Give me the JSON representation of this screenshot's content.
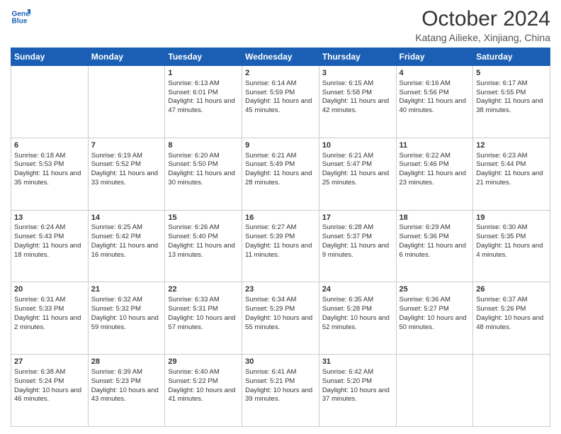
{
  "logo": {
    "line1": "General",
    "line2": "Blue"
  },
  "title": "October 2024",
  "subtitle": "Katang Ailieke, Xinjiang, China",
  "days_of_week": [
    "Sunday",
    "Monday",
    "Tuesday",
    "Wednesday",
    "Thursday",
    "Friday",
    "Saturday"
  ],
  "weeks": [
    [
      {
        "day": "",
        "info": ""
      },
      {
        "day": "",
        "info": ""
      },
      {
        "day": "1",
        "info": "Sunrise: 6:13 AM\nSunset: 6:01 PM\nDaylight: 11 hours and 47 minutes."
      },
      {
        "day": "2",
        "info": "Sunrise: 6:14 AM\nSunset: 5:59 PM\nDaylight: 11 hours and 45 minutes."
      },
      {
        "day": "3",
        "info": "Sunrise: 6:15 AM\nSunset: 5:58 PM\nDaylight: 11 hours and 42 minutes."
      },
      {
        "day": "4",
        "info": "Sunrise: 6:16 AM\nSunset: 5:56 PM\nDaylight: 11 hours and 40 minutes."
      },
      {
        "day": "5",
        "info": "Sunrise: 6:17 AM\nSunset: 5:55 PM\nDaylight: 11 hours and 38 minutes."
      }
    ],
    [
      {
        "day": "6",
        "info": "Sunrise: 6:18 AM\nSunset: 5:53 PM\nDaylight: 11 hours and 35 minutes."
      },
      {
        "day": "7",
        "info": "Sunrise: 6:19 AM\nSunset: 5:52 PM\nDaylight: 11 hours and 33 minutes."
      },
      {
        "day": "8",
        "info": "Sunrise: 6:20 AM\nSunset: 5:50 PM\nDaylight: 11 hours and 30 minutes."
      },
      {
        "day": "9",
        "info": "Sunrise: 6:21 AM\nSunset: 5:49 PM\nDaylight: 11 hours and 28 minutes."
      },
      {
        "day": "10",
        "info": "Sunrise: 6:21 AM\nSunset: 5:47 PM\nDaylight: 11 hours and 25 minutes."
      },
      {
        "day": "11",
        "info": "Sunrise: 6:22 AM\nSunset: 5:46 PM\nDaylight: 11 hours and 23 minutes."
      },
      {
        "day": "12",
        "info": "Sunrise: 6:23 AM\nSunset: 5:44 PM\nDaylight: 11 hours and 21 minutes."
      }
    ],
    [
      {
        "day": "13",
        "info": "Sunrise: 6:24 AM\nSunset: 5:43 PM\nDaylight: 11 hours and 18 minutes."
      },
      {
        "day": "14",
        "info": "Sunrise: 6:25 AM\nSunset: 5:42 PM\nDaylight: 11 hours and 16 minutes."
      },
      {
        "day": "15",
        "info": "Sunrise: 6:26 AM\nSunset: 5:40 PM\nDaylight: 11 hours and 13 minutes."
      },
      {
        "day": "16",
        "info": "Sunrise: 6:27 AM\nSunset: 5:39 PM\nDaylight: 11 hours and 11 minutes."
      },
      {
        "day": "17",
        "info": "Sunrise: 6:28 AM\nSunset: 5:37 PM\nDaylight: 11 hours and 9 minutes."
      },
      {
        "day": "18",
        "info": "Sunrise: 6:29 AM\nSunset: 5:36 PM\nDaylight: 11 hours and 6 minutes."
      },
      {
        "day": "19",
        "info": "Sunrise: 6:30 AM\nSunset: 5:35 PM\nDaylight: 11 hours and 4 minutes."
      }
    ],
    [
      {
        "day": "20",
        "info": "Sunrise: 6:31 AM\nSunset: 5:33 PM\nDaylight: 11 hours and 2 minutes."
      },
      {
        "day": "21",
        "info": "Sunrise: 6:32 AM\nSunset: 5:32 PM\nDaylight: 10 hours and 59 minutes."
      },
      {
        "day": "22",
        "info": "Sunrise: 6:33 AM\nSunset: 5:31 PM\nDaylight: 10 hours and 57 minutes."
      },
      {
        "day": "23",
        "info": "Sunrise: 6:34 AM\nSunset: 5:29 PM\nDaylight: 10 hours and 55 minutes."
      },
      {
        "day": "24",
        "info": "Sunrise: 6:35 AM\nSunset: 5:28 PM\nDaylight: 10 hours and 52 minutes."
      },
      {
        "day": "25",
        "info": "Sunrise: 6:36 AM\nSunset: 5:27 PM\nDaylight: 10 hours and 50 minutes."
      },
      {
        "day": "26",
        "info": "Sunrise: 6:37 AM\nSunset: 5:26 PM\nDaylight: 10 hours and 48 minutes."
      }
    ],
    [
      {
        "day": "27",
        "info": "Sunrise: 6:38 AM\nSunset: 5:24 PM\nDaylight: 10 hours and 46 minutes."
      },
      {
        "day": "28",
        "info": "Sunrise: 6:39 AM\nSunset: 5:23 PM\nDaylight: 10 hours and 43 minutes."
      },
      {
        "day": "29",
        "info": "Sunrise: 6:40 AM\nSunset: 5:22 PM\nDaylight: 10 hours and 41 minutes."
      },
      {
        "day": "30",
        "info": "Sunrise: 6:41 AM\nSunset: 5:21 PM\nDaylight: 10 hours and 39 minutes."
      },
      {
        "day": "31",
        "info": "Sunrise: 6:42 AM\nSunset: 5:20 PM\nDaylight: 10 hours and 37 minutes."
      },
      {
        "day": "",
        "info": ""
      },
      {
        "day": "",
        "info": ""
      }
    ]
  ]
}
